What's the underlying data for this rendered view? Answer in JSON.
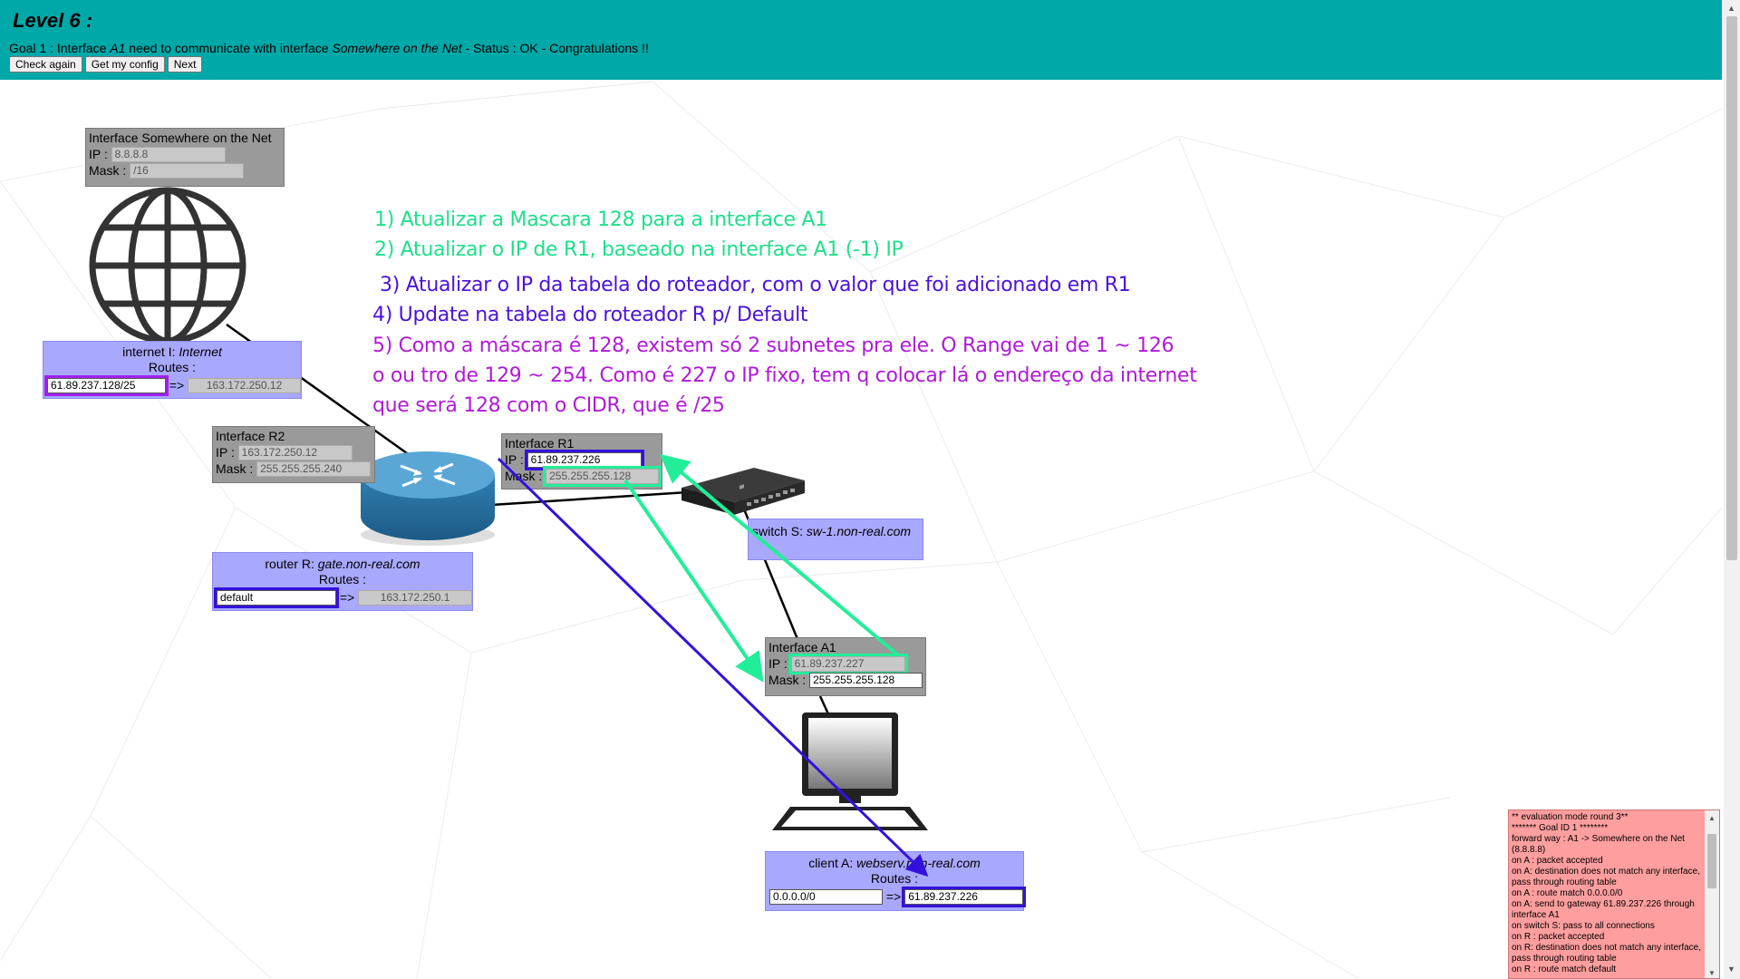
{
  "header": {
    "level": "Level 6 :",
    "goal_prefix": "Goal 1 : Interface ",
    "goal_src": "A1",
    "goal_mid": " need to communicate with interface ",
    "goal_dst": "Somewhere on the Net",
    "goal_status": " - Status : OK - Congratulations !!",
    "buttons": {
      "check": "Check again",
      "config": "Get my config",
      "next": "Next"
    }
  },
  "nodes": {
    "somewhere": {
      "title": "Interface Somewhere on the Net",
      "ip_label": "IP :",
      "ip": "8.8.8.8",
      "mask_label": "Mask :",
      "mask": "/16"
    },
    "internet": {
      "title_prefix": "internet I: ",
      "title_name": "Internet",
      "routes_label": "Routes :",
      "route_dest": "61.89.237.128/25",
      "arrow": "=>",
      "route_gw": "163.172.250.12"
    },
    "r2": {
      "title": "Interface R2",
      "ip_label": "IP :",
      "ip": "163.172.250.12",
      "mask_label": "Mask :",
      "mask": "255.255.255.240"
    },
    "router": {
      "title_prefix": "router R: ",
      "title_name": "gate.non-real.com",
      "routes_label": "Routes :",
      "route_dest": "default",
      "arrow": "=>",
      "route_gw": "163.172.250.1"
    },
    "r1": {
      "title": "Interface R1",
      "ip_label": "IP :",
      "ip": "61.89.237.226",
      "mask_label": "Mask :",
      "mask": "255.255.255.128"
    },
    "switch": {
      "title_prefix": "switch S: ",
      "title_name": "sw-1.non-real.com"
    },
    "a1": {
      "title": "Interface A1",
      "ip_label": "IP :",
      "ip": "61.89.237.227",
      "mask_label": "Mask :",
      "mask": "255.255.255.128"
    },
    "client": {
      "title_prefix": "client A: ",
      "title_name": "webserv.non-real.com",
      "routes_label": "Routes :",
      "route_dest": "0.0.0.0/0",
      "arrow": "=>",
      "route_gw": "61.89.237.226"
    }
  },
  "annotations": [
    {
      "text": "1) Atualizar a Mascara 128 para a interface A1",
      "color": "#1ee08a"
    },
    {
      "text": "2) Atualizar o IP de R1, baseado na interface A1 (-1) IP",
      "color": "#1ee08a"
    },
    {
      "text": "3) Atualizar o IP da tabela do roteador, com o valor que foi adicionado em R1",
      "color": "#4b12d8"
    },
    {
      "text": "4) Update na tabela do roteador R p/ Default",
      "color": "#4b12d8"
    },
    {
      "text": "5) Como a máscara é 128, existem só 2 subnetes pra ele. O Range vai de 1 ~ 126",
      "color": "#b01ad8"
    },
    {
      "text": "o ou tro de 129 ~ 254. Como é 227 o IP fixo, tem q colocar lá o endereço da internet",
      "color": "#b01ad8"
    },
    {
      "text": "que será 128 com o CIDR, que é /25",
      "color": "#b01ad8"
    }
  ],
  "log": {
    "lines": [
      "** evaluation mode round 3**",
      "******* Goal ID 1 ********",
      "forward way : A1 -> Somewhere on the Net (8.8.8.8)",
      "on A : packet accepted",
      "on A: destination does not match any interface, pass through routing table",
      "on A : route match 0.0.0.0/0",
      "on A: send to gateway 61.89.237.226 through interface A1",
      "on switch S: pass to all connections",
      "on R : packet accepted",
      "on R: destination does not match any interface, pass through routing table",
      "on R : route match default"
    ]
  },
  "icons": [
    "globe-icon",
    "router-icon",
    "switch-icon",
    "computer-icon"
  ]
}
